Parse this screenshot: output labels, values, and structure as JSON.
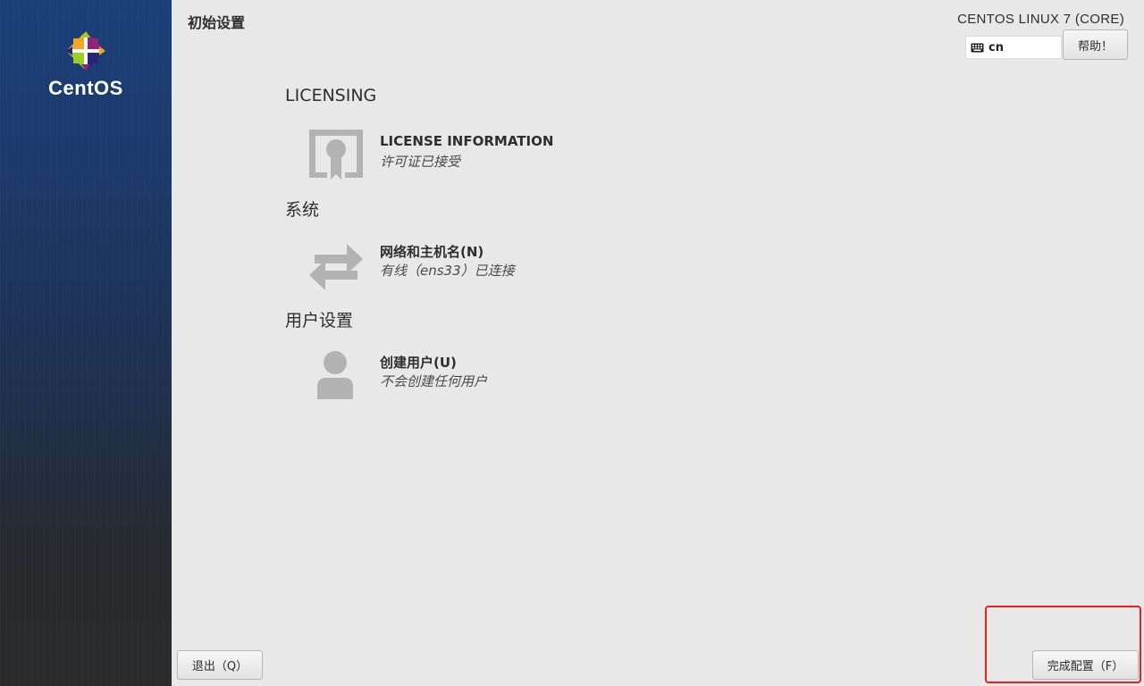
{
  "sidebar": {
    "logo_text": "CentOS",
    "logo_colors": [
      "#9ccd2a",
      "#932279",
      "#efa724",
      "#262577"
    ]
  },
  "header": {
    "page_title": "初始设置",
    "product_title": "CENTOS LINUX 7 (CORE)",
    "keyboard_layout": "cn",
    "keyboard_icon": "keyboard-icon",
    "help_label": "帮助！"
  },
  "sections": [
    {
      "title": "LICENSING",
      "spokes": [
        {
          "icon": "license-certificate-icon",
          "title": "LICENSE INFORMATION",
          "status": "许可证已接受"
        }
      ]
    },
    {
      "title": "系统",
      "spokes": [
        {
          "icon": "network-arrows-icon",
          "title": "网络和主机名(N)",
          "status": "有线（ens33）已连接"
        }
      ]
    },
    {
      "title": "用户设置",
      "spokes": [
        {
          "icon": "user-icon",
          "title": "创建用户(U)",
          "status": "不会创建任何用户"
        }
      ]
    }
  ],
  "footer": {
    "quit_label": "退出（Q）",
    "finish_label": "完成配置（F）"
  },
  "colors": {
    "sidebar_top": "#1b3f7a",
    "sidebar_bottom": "#2b2b2b",
    "background": "#e8e8e8",
    "icon_gray": "#b3b3b3",
    "highlight": "#e8221b"
  }
}
